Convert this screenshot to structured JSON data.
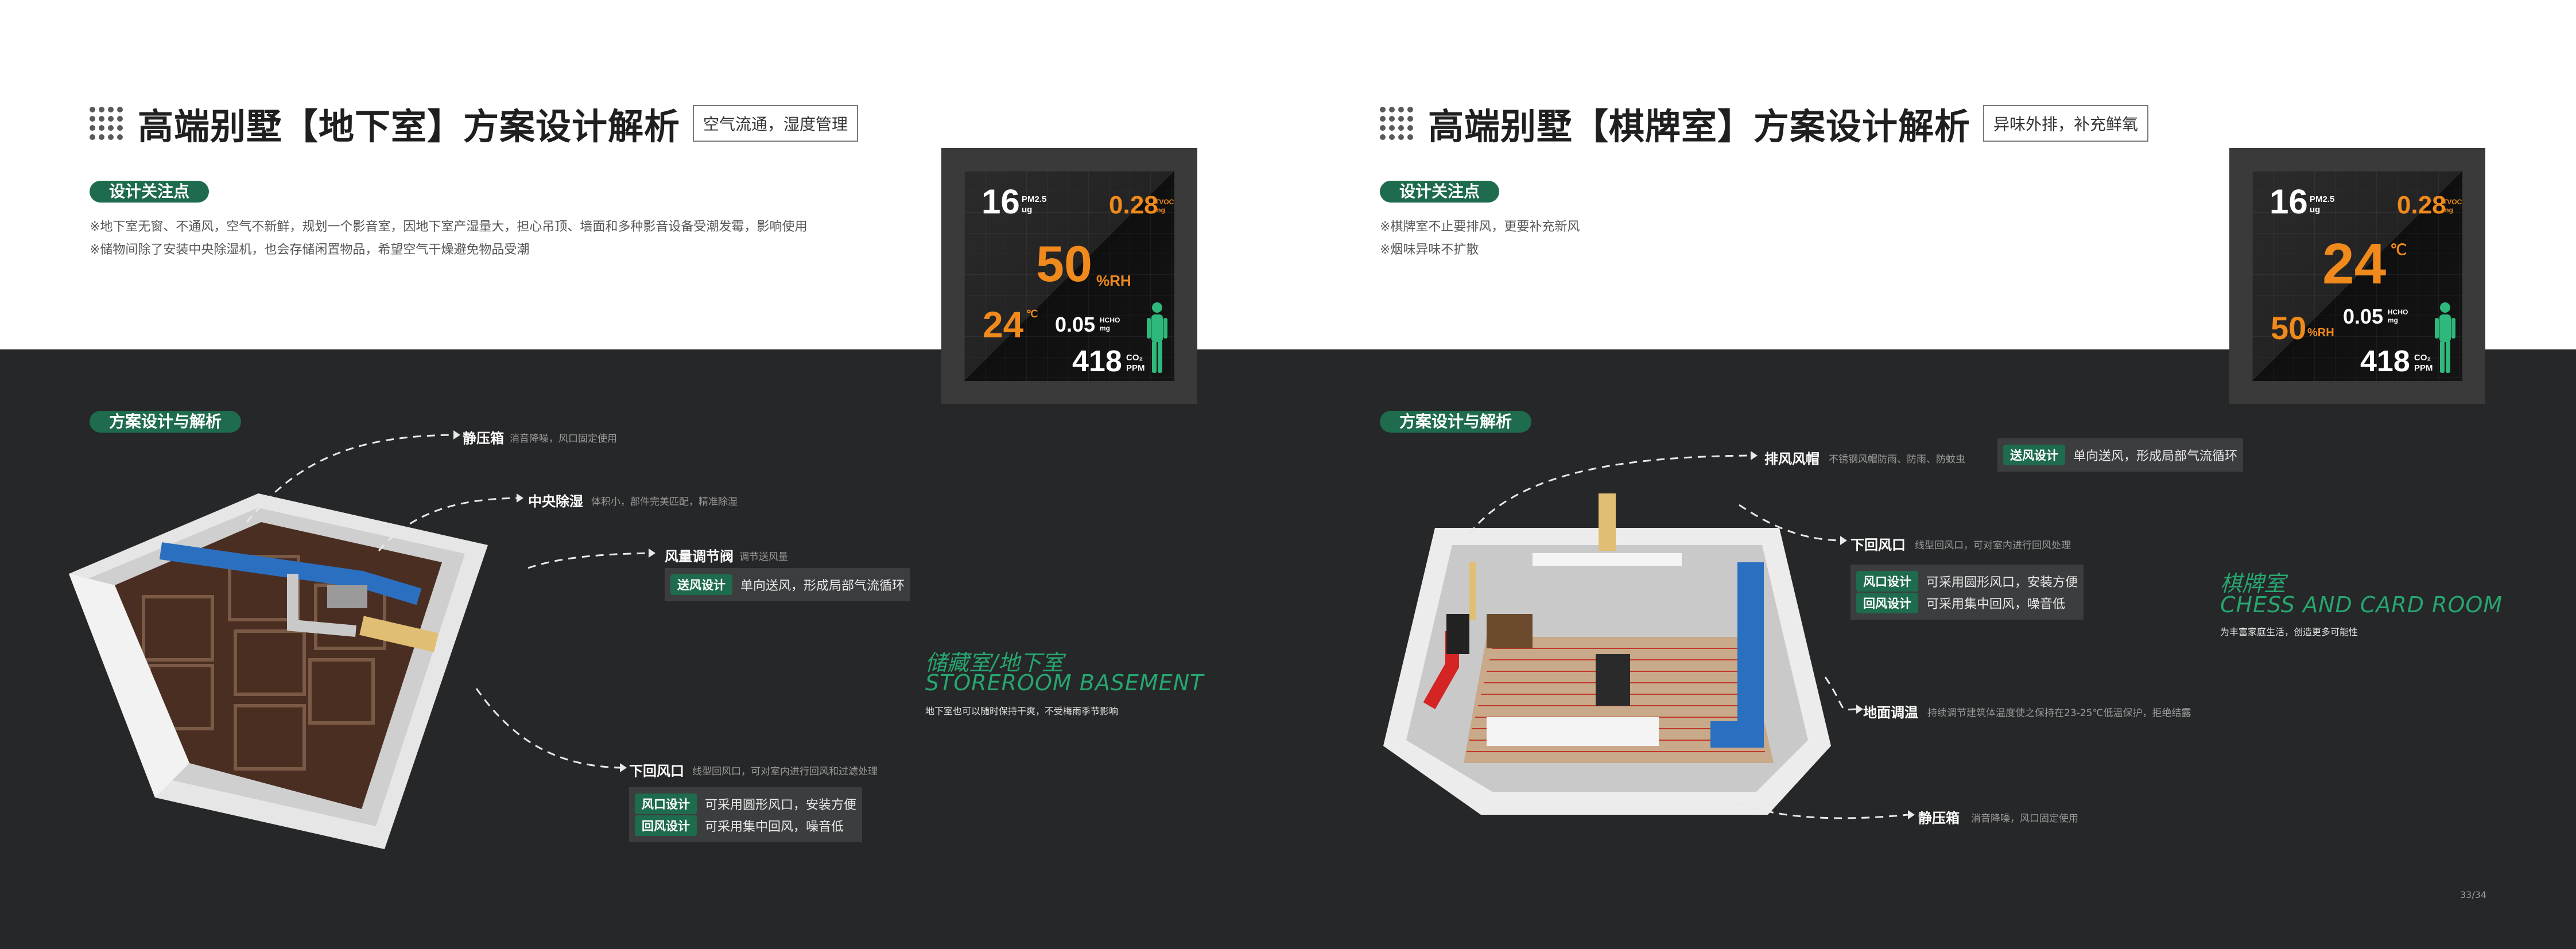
{
  "left": {
    "title": "高端别墅【地下室】方案设计解析",
    "subtitle": "空气流通，湿度管理",
    "focus_label": "设计关注点",
    "notes": [
      "※地下室无窗、不通风，空气不新鲜，规划一个影音室，因地下室产湿量大，担心吊顶、墙面和多种影音设备受潮发霉，影响使用",
      "※储物间除了安装中央除湿机，也会存储闲置物品，希望空气干燥避免物品受潮"
    ],
    "monitor": {
      "pm25": "16",
      "pm25_unit_top": "PM2.5",
      "pm25_unit_bottom": "ug",
      "tvoc": "0.28",
      "tvoc_unit_top": "TVOC",
      "tvoc_unit_bottom": "mg",
      "big": "50",
      "big_unit": "%RH",
      "small": "24",
      "small_unit": "℃",
      "hcho": "0.05",
      "hcho_unit_top": "HCHO",
      "hcho_unit_bottom": "mg",
      "co2": "418",
      "co2_unit_top": "CO₂",
      "co2_unit_bottom": "PPM"
    },
    "analysis_label": "方案设计与解析",
    "callouts": {
      "c1": {
        "title": "静压箱",
        "desc": "消音降噪，风口固定使用"
      },
      "c2": {
        "title": "中央除湿",
        "desc": "体积小，部件完美匹配，精准除湿"
      },
      "c3": {
        "title": "风量调节阀",
        "desc": "调节送风量"
      },
      "c4": {
        "title": "下回风口",
        "desc": "线型回风口，可对室内进行回风和过滤处理"
      }
    },
    "box1": [
      {
        "tag": "送风设计",
        "text": "单向送风，形成局部气流循环"
      }
    ],
    "box2": [
      {
        "tag": "风口设计",
        "text": "可采用圆形风口，安装方便"
      },
      {
        "tag": "回风设计",
        "text": "可采用集中回风，噪音低"
      }
    ],
    "room_cn": "储藏室/地下室",
    "room_en": "STOREROOM BASEMENT",
    "room_desc": "地下室也可以随时保持干爽，不受梅雨季节影响"
  },
  "right": {
    "title": "高端别墅【棋牌室】方案设计解析",
    "subtitle": "异味外排，补充鲜氧",
    "focus_label": "设计关注点",
    "notes": [
      "※棋牌室不止要排风，更要补充新风",
      "※烟味异味不扩散"
    ],
    "monitor": {
      "pm25": "16",
      "pm25_unit_top": "PM2.5",
      "pm25_unit_bottom": "ug",
      "tvoc": "0.28",
      "tvoc_unit_top": "TVOC",
      "tvoc_unit_bottom": "mg",
      "big": "24",
      "big_unit": "℃",
      "small": "50",
      "small_unit": "%RH",
      "hcho": "0.05",
      "hcho_unit_top": "HCHO",
      "hcho_unit_bottom": "mg",
      "co2": "418",
      "co2_unit_top": "CO₂",
      "co2_unit_bottom": "PPM"
    },
    "analysis_label": "方案设计与解析",
    "callouts": {
      "c1": {
        "title": "排风风帽",
        "desc": "不锈钢风帽防雨、防雨、防蚊虫"
      },
      "c2": {
        "title": "下回风口",
        "desc": "线型回风口，可对室内进行回风处理"
      },
      "c3": {
        "title": "地面调温",
        "desc": "持续调节建筑体温度使之保持在23-25℃低温保护，拒绝结露"
      },
      "c4": {
        "title": "静压箱",
        "desc": "消音降噪，风口固定使用"
      }
    },
    "box1": [
      {
        "tag": "送风设计",
        "text": "单向送风，形成局部气流循环"
      }
    ],
    "box2": [
      {
        "tag": "风口设计",
        "text": "可采用圆形风口，安装方便"
      },
      {
        "tag": "回风设计",
        "text": "可采用集中回风，噪音低"
      }
    ],
    "room_cn": "棋牌室",
    "room_en": "CHESS AND CARD ROOM",
    "room_desc": "为丰富家庭生活，创造更多可能性"
  },
  "page_number": "33/34",
  "colors": {
    "accent": "#1f6b4e",
    "room_text": "#27a66f",
    "reading_orange": "#f08a1c",
    "dark_bg": "#262728"
  }
}
